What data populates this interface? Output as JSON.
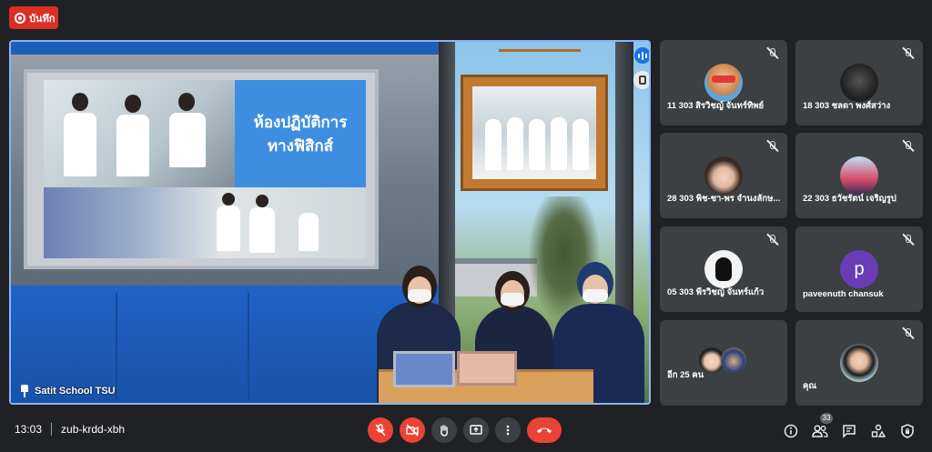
{
  "recording": {
    "label": "บันทึก"
  },
  "main_video": {
    "presenter_name": "Satit School TSU",
    "slide_title_line1": "ห้องปฏิบัติการ",
    "slide_title_line2": "ทางฟิสิกส์"
  },
  "participants": [
    {
      "name": "11 303 สิรวิชญ์ จันทร์ทิพย์",
      "avatar": "dog-avatar",
      "muted": true
    },
    {
      "name": "18 303 ชลดา พงศ์สว่าง",
      "avatar": "character-avatar",
      "muted": true
    },
    {
      "name": "28 303 พิช-ชา-พร จำนงลักษ...",
      "avatar": "photo-avatar",
      "muted": true
    },
    {
      "name": "22 303 ธวัชรัตน์ เจริญรูป",
      "avatar": "photo-avatar",
      "muted": true
    },
    {
      "name": "05 303 พีรวิชญ์ จันทร์แก้ว",
      "avatar": "mask-avatar",
      "muted": true
    },
    {
      "name": "paveenuth chansuk",
      "avatar_letter": "p",
      "avatar_color": "#6a3cb8",
      "muted": true
    },
    {
      "name": "อีก 25 คน",
      "avatar": "group-avatars",
      "muted": false
    },
    {
      "name": "คุณ",
      "avatar": "self-avatar",
      "muted": true
    }
  ],
  "meeting": {
    "time": "13:03",
    "code": "zub-krdd-xbh"
  },
  "controls": [
    {
      "name": "microphone-off",
      "state": "off"
    },
    {
      "name": "camera-off",
      "state": "off"
    },
    {
      "name": "raise-hand"
    },
    {
      "name": "present-screen"
    },
    {
      "name": "more-options"
    },
    {
      "name": "leave-call"
    }
  ],
  "right_controls": {
    "participant_count": "33"
  },
  "colors": {
    "accent": "#8ab4f8",
    "danger": "#ea4335",
    "tile": "#3c4043",
    "background": "#202124"
  }
}
